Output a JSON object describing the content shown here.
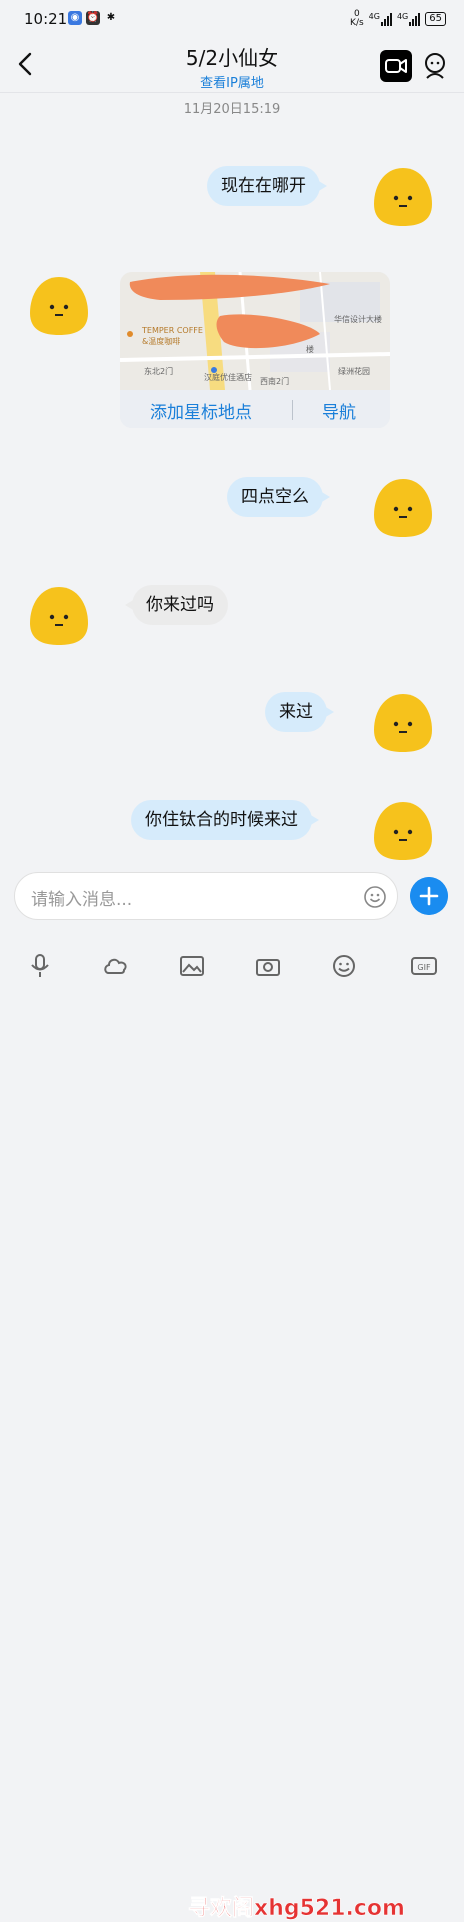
{
  "status_bar": {
    "time": "10:21",
    "net_speed": "0",
    "net_unit": "K/s",
    "signal1": "4G",
    "signal2": "4G",
    "battery": "65"
  },
  "header": {
    "title": "5/2小仙女",
    "subtitle": "查看IP属地",
    "video_icon": "video-call-icon",
    "profile_icon": "profile-icon"
  },
  "chat": {
    "timestamp": "11月20日15:19",
    "messages": [
      {
        "side": "out",
        "text": "现在在哪开"
      },
      {
        "side": "in",
        "type": "location"
      },
      {
        "side": "out",
        "text": "四点空么"
      },
      {
        "side": "in",
        "text": "你来过吗"
      },
      {
        "side": "out",
        "text": "来过"
      },
      {
        "side": "out",
        "text": "你住钛合的时候来过"
      }
    ]
  },
  "location_card": {
    "action_star": "添加星标地点",
    "action_nav": "导航",
    "map_labels": [
      "TEMPER COFFE",
      "&温度咖啡",
      "东北2门",
      "汉庭优佳酒店",
      "西南2门",
      "华信设计大楼",
      "楼",
      "绿洲花园"
    ]
  },
  "composer": {
    "placeholder": "请输入消息..."
  },
  "toolbar": {
    "icons": [
      "mic-icon",
      "cloud-icon",
      "image-icon",
      "camera-icon",
      "emoji-icon",
      "gif-icon"
    ]
  },
  "watermark": "寻欢阁xhg521.com",
  "colors": {
    "accent": "#1a7fd9",
    "bubble_out": "#d6ebfb",
    "bubble_in": "#ebebeb",
    "avatar": "#f6c21c"
  }
}
